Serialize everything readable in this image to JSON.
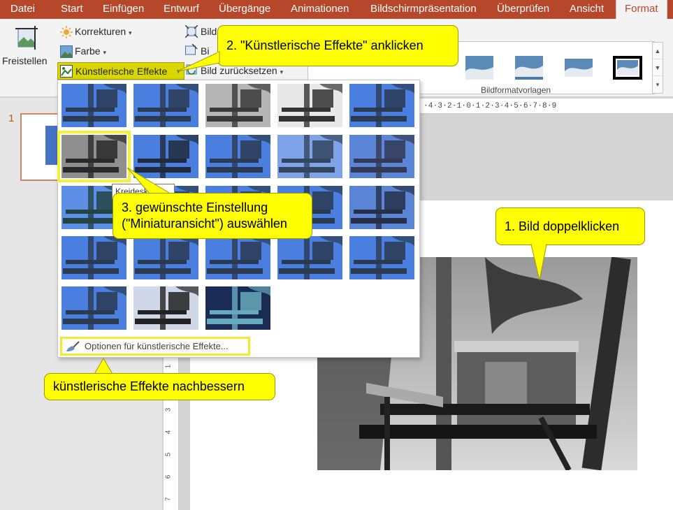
{
  "menu": {
    "tabs": [
      {
        "label": "Datei"
      },
      {
        "label": "Start"
      },
      {
        "label": "Einfügen"
      },
      {
        "label": "Entwurf"
      },
      {
        "label": "Übergänge"
      },
      {
        "label": "Animationen"
      },
      {
        "label": "Bildschirmpräsentation"
      },
      {
        "label": "Überprüfen"
      },
      {
        "label": "Ansicht"
      },
      {
        "label": "Format"
      }
    ],
    "active_tab": "Format"
  },
  "ribbon": {
    "freistellen": "Freistellen",
    "korrekturen": "Korrekturen",
    "farbe": "Farbe",
    "kuenstlerische_effekte": "Künstlerische Effekte",
    "bild_1": "Bild",
    "bild_2": "Bi",
    "bild_zuruecksetzen": "Bild zurücksetzen",
    "group_bildformatvorlagen": "Bildformatvorlagen",
    "gallery_scroll_arrows": [
      "▲",
      "▼",
      "▾"
    ]
  },
  "slides": {
    "number": "1"
  },
  "ruler": {
    "top": "·4·3·2·1·0·1·2·3·4·5·6·7·8·9"
  },
  "ruler_left_labels": [
    "1",
    "2",
    "3",
    "4",
    "5",
    "6",
    "7"
  ],
  "effects": {
    "tooltip": "Kreideskizze",
    "options_label": "Optionen für künstlerische Effekte...",
    "count": 23,
    "selected_index": 5
  },
  "callouts": {
    "step1": "1. Bild doppelklicken",
    "step2": "2. \"Künstlerische Effekte\" anklicken",
    "step3_line1": "3. gewünschte Einstellung",
    "step3_line2": "(\"Miniaturansicht\") auswählen",
    "fine_tune": "künstlerische Effekte nachbessern"
  },
  "colors": {
    "accent": "#b7472a",
    "callout": "#ffff00",
    "highlight": "#f0ea32"
  }
}
